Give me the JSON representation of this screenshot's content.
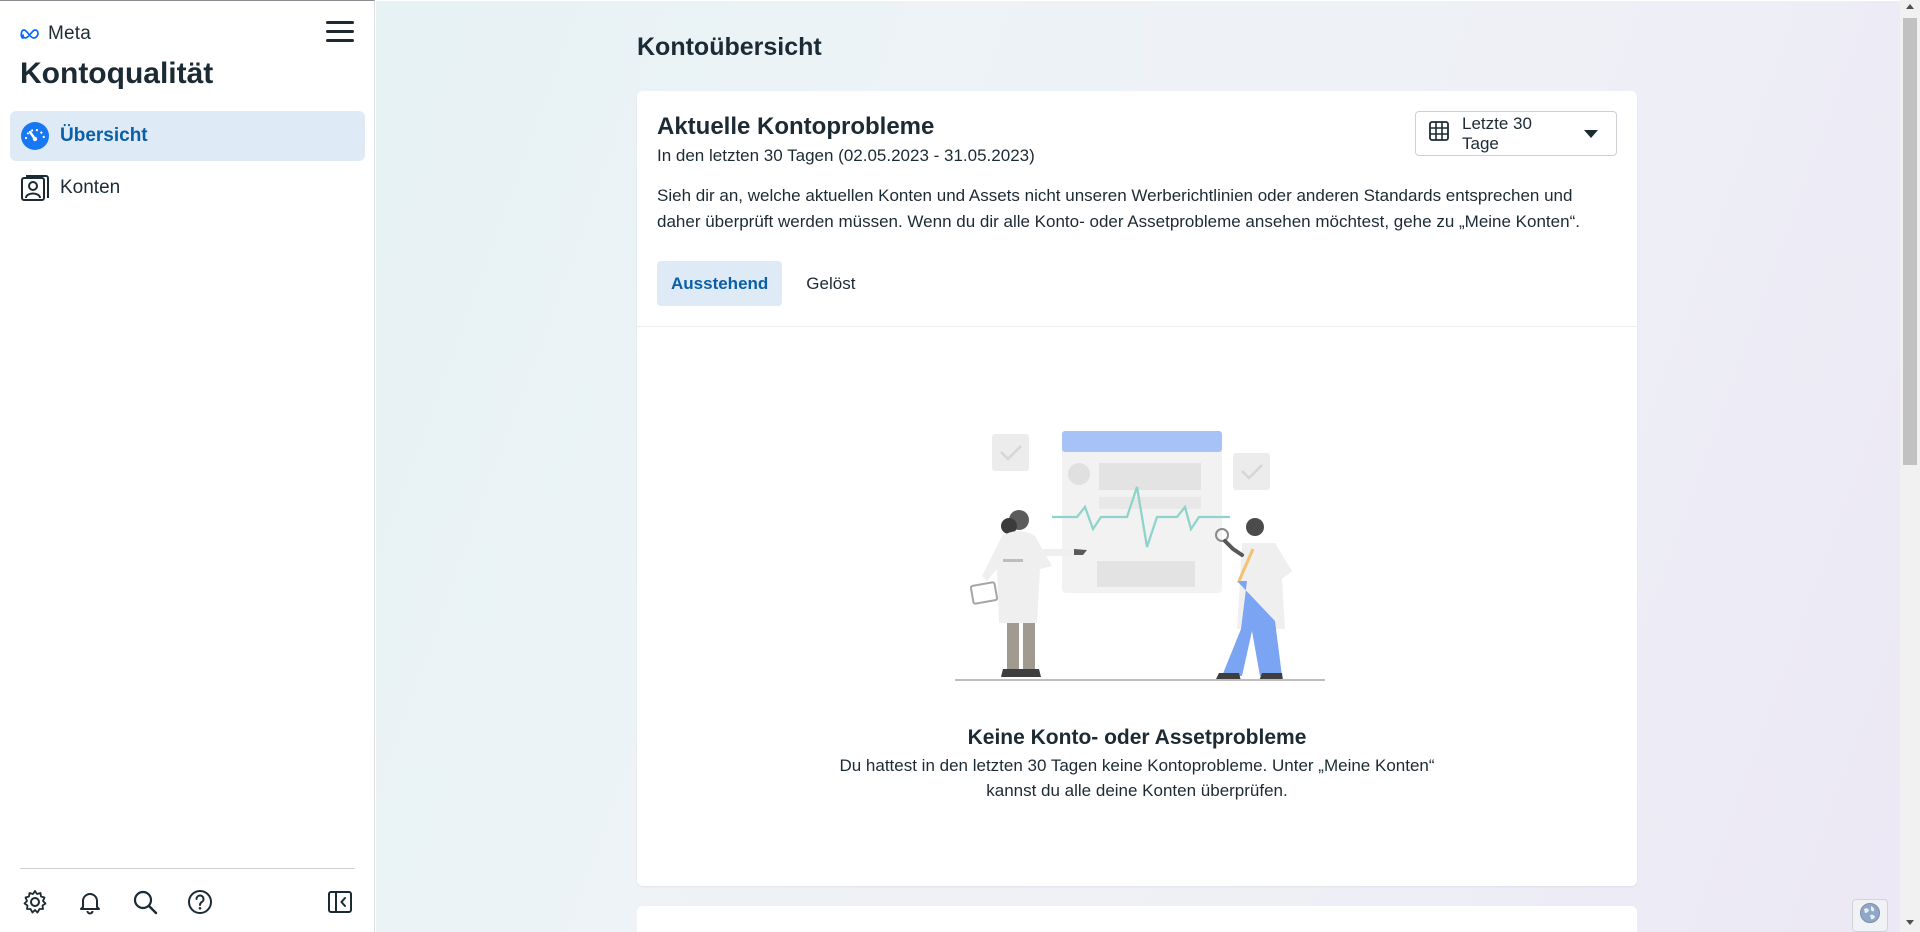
{
  "brand": {
    "name": "Meta",
    "logo_icon": "meta-infinity-icon"
  },
  "sidebar": {
    "title": "Kontoqualität",
    "menu_icon": "hamburger-menu-icon",
    "items": [
      {
        "label": "Übersicht",
        "icon": "dashboard-gauge-icon",
        "active": true
      },
      {
        "label": "Konten",
        "icon": "account-profile-icon",
        "active": false
      }
    ],
    "footer_icons": [
      "settings-gear-icon",
      "notifications-bell-icon",
      "search-icon",
      "help-question-icon",
      "collapse-sidebar-icon"
    ]
  },
  "main": {
    "page_title": "Kontoübersicht",
    "card": {
      "title": "Aktuelle Kontoprobleme",
      "subtitle": "In den letzten 30 Tagen (02.05.2023 - 31.05.2023)",
      "description": "Sieh dir an, welche aktuellen Konten und Assets nicht unseren Werberichtlinien oder anderen Standards entsprechen und daher überprüft werden müssen. Wenn du dir alle Konto- oder Assetprobleme ansehen möchtest, gehe zu „Meine Konten“.",
      "date_range": {
        "selected": "Letzte 30 Tage",
        "icon": "calendar-table-icon"
      },
      "tabs": [
        {
          "label": "Ausstehend",
          "active": true
        },
        {
          "label": "Gelöst",
          "active": false
        }
      ],
      "empty_state": {
        "illustration": "doctors-examining-monitor-illustration",
        "title": "Keine Konto- oder Assetprobleme",
        "text": "Du hattest in den letzten 30 Tagen keine Kontoprobleme. Unter „Meine Konten“ kannst du alle deine Konten überprüfen."
      }
    }
  },
  "colors": {
    "accent": "#0a5fa8",
    "active_bg": "#deebf7",
    "text": "#1c2b33",
    "meta_blue": "#0866ff"
  }
}
